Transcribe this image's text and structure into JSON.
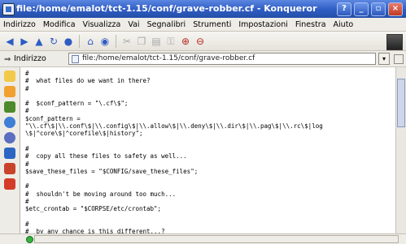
{
  "window": {
    "title": "file:/home/emalot/tct-1.15/conf/grave-robber.cf - Konqueror",
    "buttons": [
      "?",
      "_",
      "▫",
      "×"
    ]
  },
  "menu": {
    "items": [
      "Indirizzo",
      "Modifica",
      "Visualizza",
      "Vai",
      "Segnalibri",
      "Strumenti",
      "Impostazioni",
      "Finestra",
      "Aiuto"
    ]
  },
  "toolbar": {
    "icons": [
      "back-icon",
      "forward-icon",
      "up-icon",
      "reload-icon",
      "stop-icon",
      "home-icon",
      "print-icon",
      "cut-icon",
      "copy-icon",
      "paste-icon",
      "security-icon",
      "zoom-in-icon",
      "zoom-out-icon"
    ],
    "accent": "#2d5cc4"
  },
  "location": {
    "label": "Indirizzo",
    "url": "file:/home/emalot/tct-1.15/conf/grave-robber.cf"
  },
  "sidebar": {
    "icons": [
      "bookmarks-icon",
      "history-icon",
      "network-icon",
      "home-folder-icon",
      "root-folder-icon",
      "services-icon",
      "removable-media-icon",
      "trash-icon"
    ]
  },
  "content": {
    "text": "#\n#  what files do we want in there?\n#\n\n#  $conf_pattern = \"\\.cf\\$\";\n#\n$conf_pattern =\n\"\\\\.cf\\$|\\\\.conf\\$|\\\\.config\\$|\\\\.allow\\$|\\\\.deny\\$|\\\\.dir\\$|\\\\.pag\\$|\\\\.rc\\$|log\n\\$|^core\\$|^corefile\\$|history\";\n\n#\n#  copy all these files to safety as well...\n#\n$save_these_files = \"$CONFIG/save_these_files\";\n\n#\n#  shouldn't be moving around too much...\n#\n$etc_crontab = \"$CORPSE/etc/crontab\";\n\n#\n#  by any chance is this different...?\n$DEVICE_DIR = \"$CORPSE/dev\";"
  }
}
